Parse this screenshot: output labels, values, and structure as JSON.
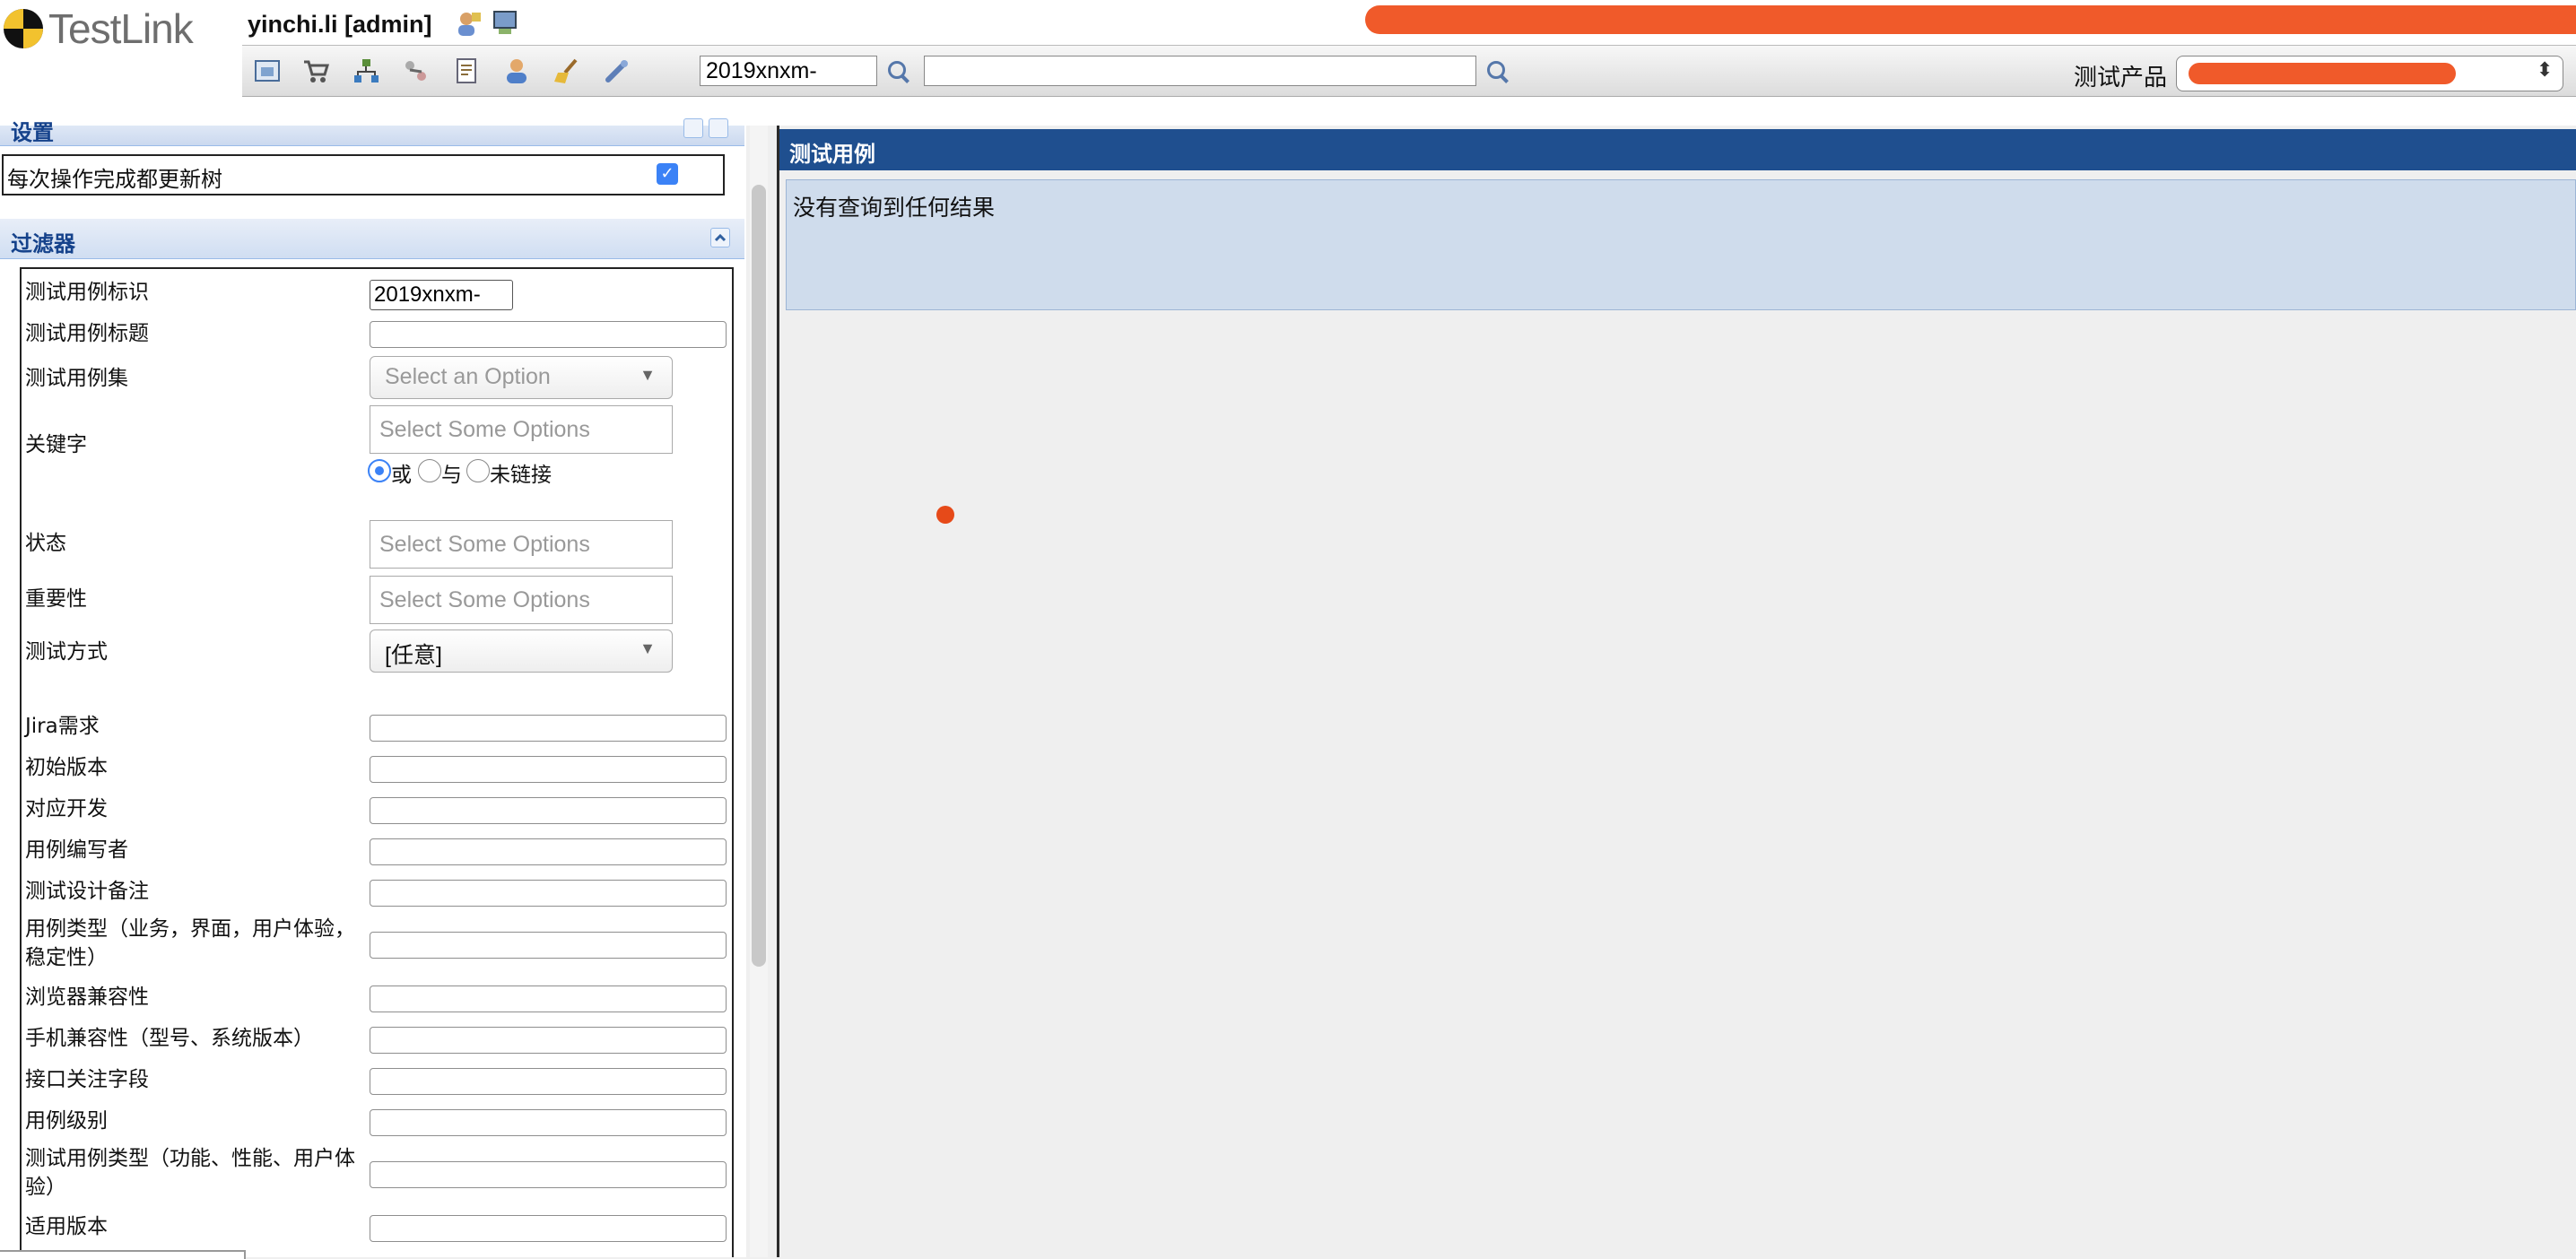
{
  "header": {
    "logo_text": "TestLink",
    "user_label": "yinchi.li [admin]",
    "redaction_color": "#f05a2a",
    "icons": [
      "user-settings-icon",
      "logout-icon"
    ]
  },
  "toolbar": {
    "icons": [
      "home-icon",
      "cart-icon",
      "tree-icon",
      "workflow-icon",
      "document-icon",
      "user-icon",
      "broom-icon",
      "key-icon"
    ],
    "tc_id_value": "2019xnxm-",
    "search_value": "",
    "product_label": "测试产品"
  },
  "left": {
    "settings_title": "设置",
    "update_tree_label": "每次操作完成都更新树",
    "update_tree_checked": true,
    "filter_title": "过滤器",
    "filters": {
      "tc_id_label": "测试用例标识",
      "tc_id_value": "2019xnxm-",
      "tc_title_label": "测试用例标题",
      "tc_suite_label": "测试用例集",
      "tc_suite_placeholder": "Select an Option",
      "keyword_label": "关键字",
      "keyword_placeholder": "Select Some Options",
      "keyword_or": "或",
      "keyword_and": "与",
      "keyword_unlinked": "未链接",
      "status_label": "状态",
      "status_placeholder": "Select Some Options",
      "importance_label": "重要性",
      "importance_placeholder": "Select Some Options",
      "exec_type_label": "测试方式",
      "exec_type_value": "[任意]",
      "jira_label": "Jira需求",
      "initial_version_label": "初始版本",
      "developer_label": "对应开发",
      "author_label": "用例编写者",
      "design_note_label": "测试设计备注",
      "case_type_label": "用例类型（业务，界面，用户体验，稳定性）",
      "browser_label": "浏览器兼容性",
      "mobile_label": "手机兼容性（型号、系统版本）",
      "api_field_label": "接口关注字段",
      "case_level_label": "用例级别",
      "tc_type_label": "测试用例类型（功能、性能、用户体验）",
      "applicable_version_label": "适用版本"
    }
  },
  "right": {
    "title": "测试用例",
    "no_results": "没有查询到任何结果"
  }
}
